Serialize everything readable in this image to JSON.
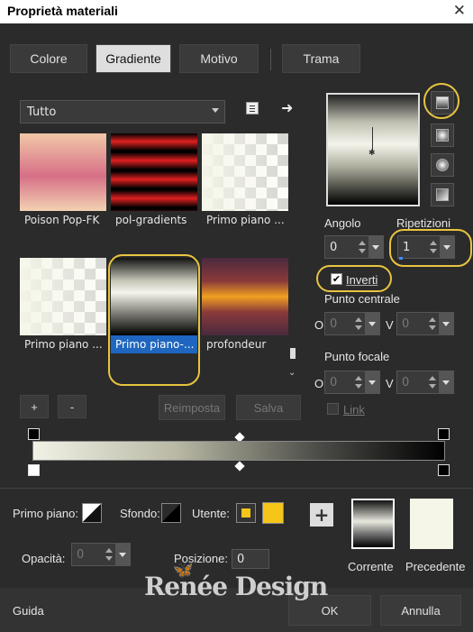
{
  "window": {
    "title": "Proprietà materiali",
    "close_glyph": "✕"
  },
  "tabs": [
    {
      "label": "Colore"
    },
    {
      "label": "Gradiente"
    },
    {
      "label": "Motivo"
    },
    {
      "label": "Trama"
    }
  ],
  "library": {
    "category": "Tutto",
    "items": [
      {
        "label": "Poison Pop-FK"
      },
      {
        "label": "pol-gradients"
      },
      {
        "label": "Primo piano ..."
      },
      {
        "label": "Primo piano ..."
      },
      {
        "label": "Primo piano-..."
      },
      {
        "label": "profondeur"
      }
    ],
    "add_label": "+",
    "remove_label": "-",
    "reset_label": "Reimposta",
    "save_label": "Salva"
  },
  "settings": {
    "angle_label": "Angolo",
    "angle_value": "0",
    "repeats_label": "Ripetizioni",
    "repeats_value": "1",
    "invert_label": "Inverti",
    "invert_checked": true,
    "center_label": "Punto centrale",
    "focal_label": "Punto focale",
    "center_h_label": "O",
    "center_h_value": "0",
    "center_v_label": "V",
    "center_v_value": "0",
    "focal_h_label": "O",
    "focal_h_value": "0",
    "focal_v_label": "V",
    "focal_v_value": "0",
    "link_label": "Link"
  },
  "stops": {
    "foreground_label": "Primo piano:",
    "background_label": "Sfondo:",
    "user_label": "Utente:",
    "user_color": "#f5c518",
    "opacity_label": "Opacità:",
    "opacity_value": "0",
    "position_label": "Posizione:",
    "position_value": "0"
  },
  "swatches": {
    "current_label": "Corrente",
    "previous_label": "Precedente"
  },
  "watermark": "Renée Design",
  "footer": {
    "help_label": "Guida",
    "ok_label": "OK",
    "cancel_label": "Annulla"
  }
}
